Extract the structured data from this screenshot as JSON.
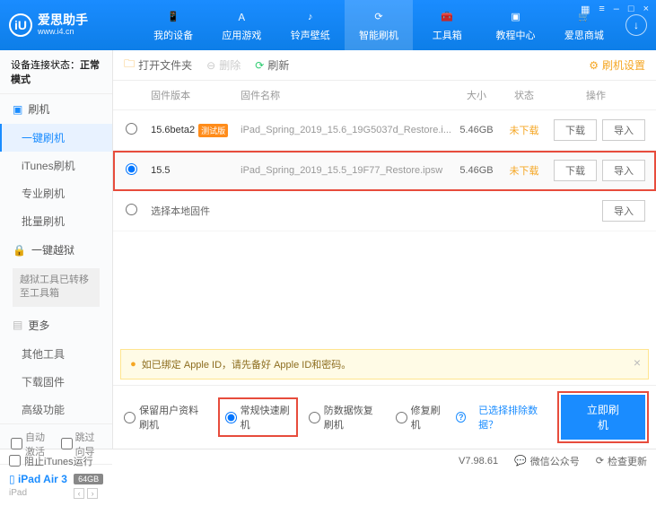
{
  "brand": {
    "glyph": "iU",
    "name": "爱思助手",
    "url": "www.i4.cn"
  },
  "title_controls": [
    "▦",
    "≡",
    "–",
    "□",
    "×"
  ],
  "nav": [
    {
      "label": "我的设备",
      "icon": "📱"
    },
    {
      "label": "应用游戏",
      "icon": "Ａ"
    },
    {
      "label": "铃声壁纸",
      "icon": "♪"
    },
    {
      "label": "智能刷机",
      "icon": "⟳"
    },
    {
      "label": "工具箱",
      "icon": "🧰"
    },
    {
      "label": "教程中心",
      "icon": "▣"
    },
    {
      "label": "爱思商城",
      "icon": "🛒"
    }
  ],
  "active_nav_index": 3,
  "conn_status_prefix": "设备连接状态：",
  "conn_status_value": "正常模式",
  "side": {
    "flash_head": "刷机",
    "flash_items": [
      "一键刷机",
      "iTunes刷机",
      "专业刷机",
      "批量刷机"
    ],
    "jail_head": "一键越狱",
    "jail_note": "越狱工具已转移至工具箱",
    "more_head": "更多",
    "more_items": [
      "其他工具",
      "下载固件",
      "高级功能"
    ]
  },
  "side_checks": {
    "auto_activate": "自动激活",
    "skip_guide": "跳过向导"
  },
  "device": {
    "name": "iPad Air 3",
    "storage": "64GB",
    "type": "iPad"
  },
  "toolbar": {
    "open_folder": "打开文件夹",
    "delete": "删除",
    "refresh": "刷新",
    "settings": "刷机设置"
  },
  "thead": {
    "version": "固件版本",
    "name": "固件名称",
    "size": "大小",
    "status": "状态",
    "action": "操作"
  },
  "rows": [
    {
      "version": "15.6beta2",
      "beta": "测试版",
      "name": "iPad_Spring_2019_15.6_19G5037d_Restore.i...",
      "size": "5.46GB",
      "status": "未下载"
    },
    {
      "version": "15.5",
      "name": "iPad_Spring_2019_15.5_19F77_Restore.ipsw",
      "size": "5.46GB",
      "status": "未下载"
    }
  ],
  "local_row": "选择本地固件",
  "btn_download": "下载",
  "btn_import": "导入",
  "warning": "如已绑定 Apple ID，请先备好 Apple ID和密码。",
  "options": {
    "keep_data": "保留用户资料刷机",
    "normal_fast": "常规快速刷机",
    "anti_recovery": "防数据恢复刷机",
    "repair": "修复刷机",
    "exclude_link": "已选择排除数据？"
  },
  "flash_button": "立即刷机",
  "statusbar": {
    "block_itunes": "阻止iTunes运行",
    "version": "V7.98.61",
    "wechat": "微信公众号",
    "check_update": "检查更新"
  }
}
